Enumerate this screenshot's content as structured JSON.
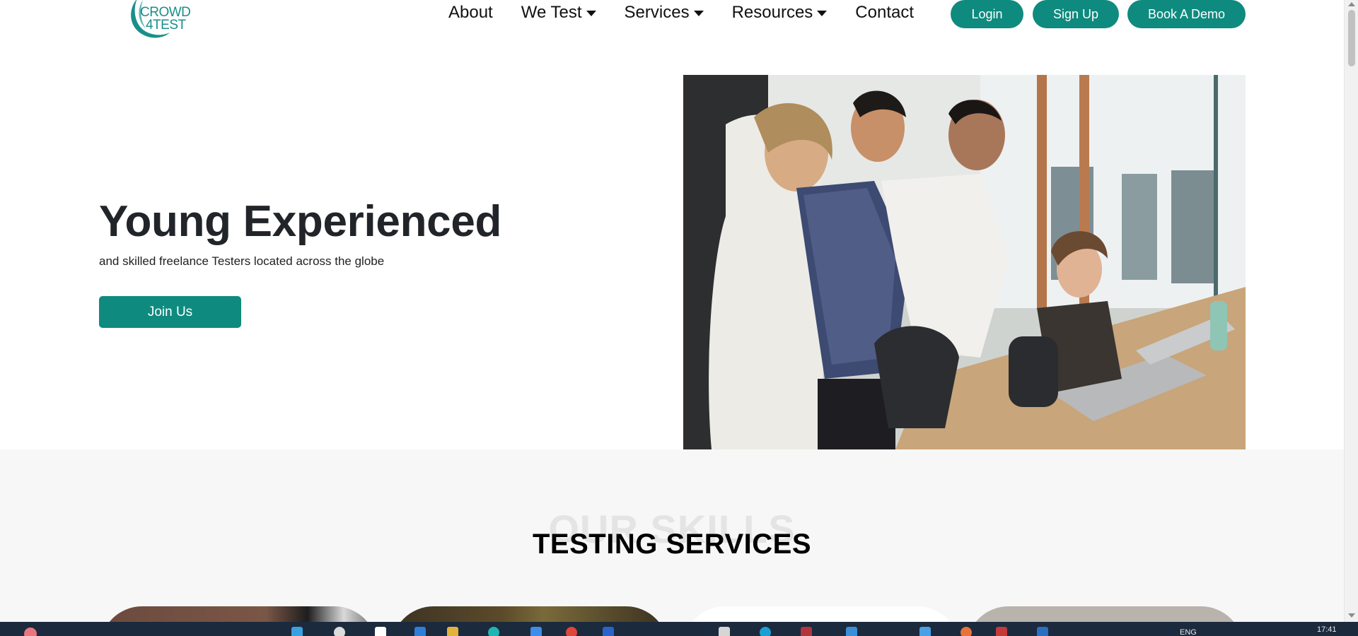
{
  "header": {
    "logo_line1": "CROWD",
    "logo_line2": "4TEST",
    "nav": [
      {
        "label": "About",
        "has_dropdown": false
      },
      {
        "label": "We Test",
        "has_dropdown": true
      },
      {
        "label": "Services",
        "has_dropdown": true
      },
      {
        "label": "Resources",
        "has_dropdown": true
      },
      {
        "label": "Contact",
        "has_dropdown": false
      }
    ],
    "login_label": "Login",
    "signup_label": "Sign Up",
    "demo_label": "Book A Demo"
  },
  "hero": {
    "title": "Young Experienced",
    "subtitle": "and skilled freelance Testers located across the globe",
    "cta_label": "Join Us"
  },
  "skills": {
    "background_text": "OUR SKILLS",
    "title": "TESTING SERVICES"
  },
  "taskbar": {
    "language": "ENG",
    "time": "17:41"
  },
  "colors": {
    "brand_teal": "#0f8a7e",
    "logo_teal": "#1a8f8a",
    "section_bg": "#f7f7f7",
    "taskbar_bg": "#1c2a3e"
  }
}
